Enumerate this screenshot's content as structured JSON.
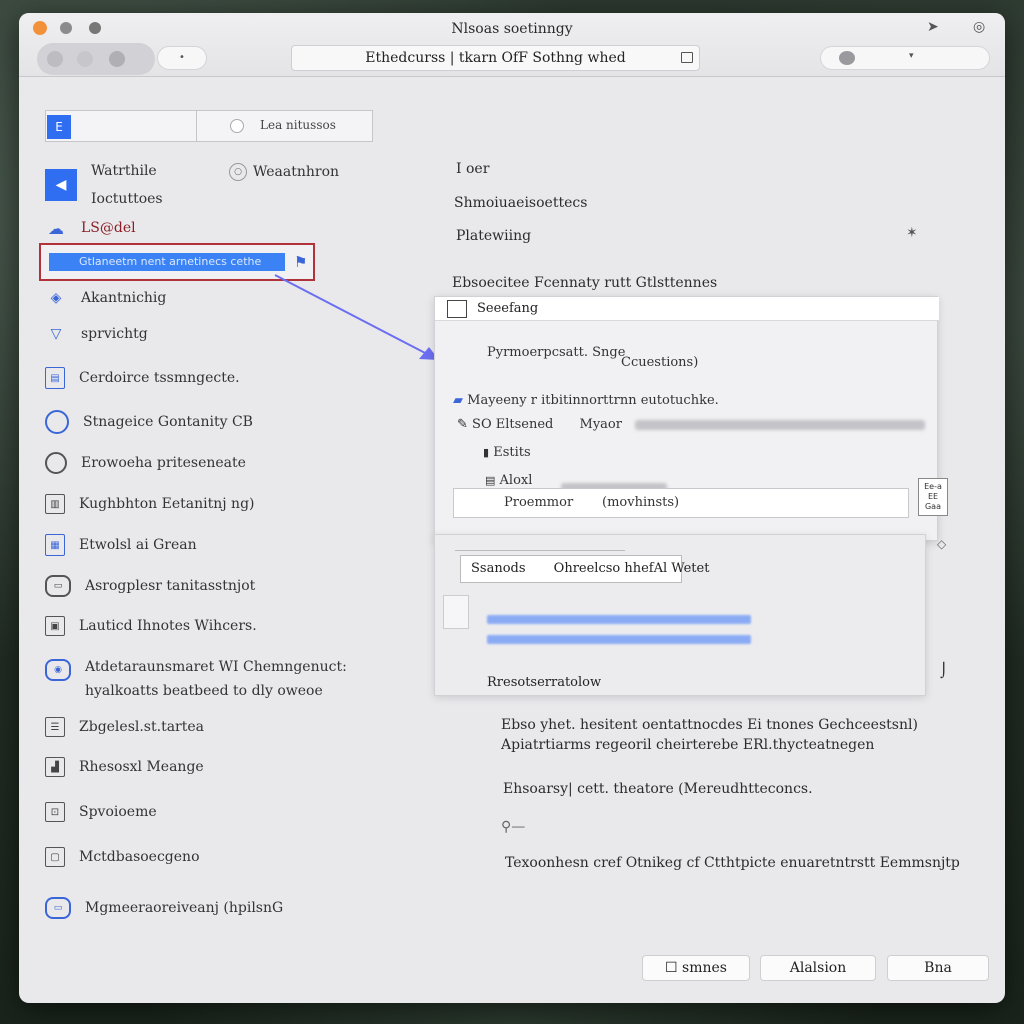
{
  "window": {
    "title": "Nlsoas soetinngy"
  },
  "toolbar": {
    "address": "Ethedcurss | tkarn OfF Sothng whed",
    "dropdown_arrow": "▾"
  },
  "sidebar": {
    "search_label": "Lea nitussos",
    "items": [
      {
        "label": "Watrthile",
        "sub": "Ioctuttoes",
        "icon": "megaphone-icon"
      },
      {
        "label": "LS@del",
        "icon": "cloud-icon"
      },
      {
        "label": "Akantnichig",
        "icon": "layers-icon"
      },
      {
        "label": "sprvichtg",
        "icon": "shield-icon"
      },
      {
        "label": "Cerdoirce tssmngecte.",
        "icon": "document-icon"
      },
      {
        "label": "Stnageice Gontanity CB",
        "icon": "circle-icon"
      },
      {
        "label": "Erowoeha priteseneate",
        "icon": "globe-icon"
      },
      {
        "label": "Kughbhton Eetanitnj ng)",
        "icon": "book-icon"
      },
      {
        "label": "Etwolsl ai Grean",
        "icon": "grid-icon"
      },
      {
        "label": "Asrogplesr tanitasstnjot",
        "icon": "monitor-icon"
      },
      {
        "label": "Lauticd Ihnotes Wihcers.",
        "icon": "archive-icon"
      },
      {
        "label": "Atdetaraunsmaret WI Chemngenuct:",
        "sub": "hyalkoatts beatbeed to dly oweoe",
        "icon": "eye-icon"
      },
      {
        "label": "Zbgelesl.st.tartea",
        "icon": "list-icon"
      },
      {
        "label": "Rhesosxl Meange",
        "icon": "chart-icon"
      },
      {
        "label": "Spvoioeme",
        "icon": "tag-icon"
      },
      {
        "label": "Mctdbasoecgeno",
        "icon": "folder-icon"
      },
      {
        "label": "Mgmeeraoreiveanj (hpilsnG",
        "icon": "camera-icon"
      }
    ],
    "selected_text": "Gtlaneetm nent arnetinecs cethe",
    "weather_label": "Weaatnhron"
  },
  "main": {
    "heading": "I oer",
    "line1": "Shmoiuaeisoettecs",
    "line2": "Platewiing",
    "line3": "Ebsoecitee Fcennaty rutt Gtlsttennes"
  },
  "popup": {
    "header": "Seeefang",
    "row1_left": "Pyrmoerpcsatt. Snge",
    "row1_right": "Ccuestions)",
    "row2": "Mayeeny r itbitinnorttrnn eutotuchke.",
    "row3": "SO Eltsened",
    "row3_b": "Myaor",
    "row4": "Estits",
    "row5": "Aloxl",
    "input_label": "Proemmor",
    "input_value": "(movhinsts)",
    "mini_box": "Ee-a\nEE\nGaa"
  },
  "popup2": {
    "button_left": "Ssanods",
    "button_right": "Ohreelcso hhefAl Wetet",
    "footer": "Rresotserratolow"
  },
  "details": {
    "line1": "Ebso yhet. hesitent oentattnocdes Ei   tnones Gechceestsnl)",
    "line2": "Apiatrtiarms regeoril cheirterebe ERl.thycteatnegen",
    "checkbox_label": "Ehsoarsy| cett. theatore (Mereudhtteconcs.",
    "bottom_line": "Texoonhesn cref Otnikeg cf Ctthtpicte enuaretntrstt Eemmsnjtp"
  },
  "footer": {
    "btn1": "☐ smnes",
    "btn2": "Alalsion",
    "btn3": "Bna"
  }
}
